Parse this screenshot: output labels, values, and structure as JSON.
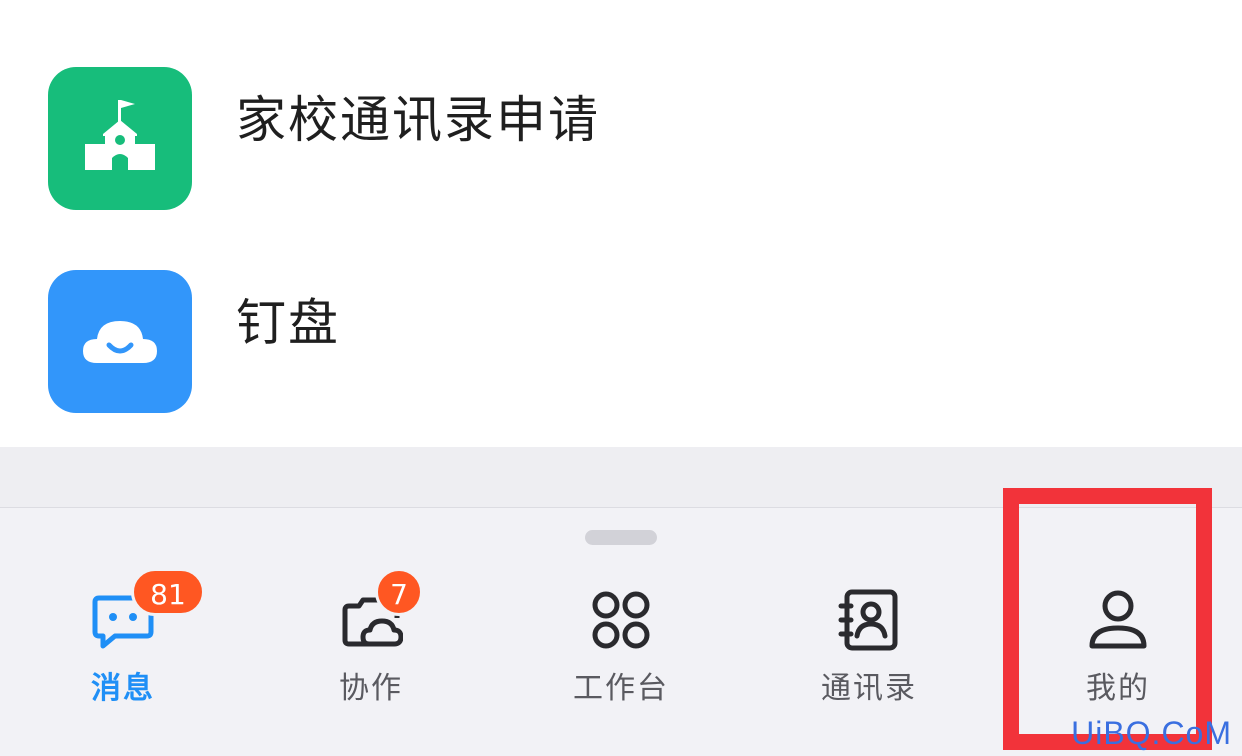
{
  "apps": [
    {
      "label": "家校通讯录申请",
      "icon": "school-icon",
      "color": "#17bd7b"
    },
    {
      "label": "钉盘",
      "icon": "cloud-smile-icon",
      "color": "#3296fa"
    }
  ],
  "tabbar": {
    "tabs": [
      {
        "label": "消息",
        "icon": "message-icon",
        "badge": "81",
        "active": true
      },
      {
        "label": "协作",
        "icon": "collab-icon",
        "badge": "7",
        "active": false
      },
      {
        "label": "工作台",
        "icon": "workbench-icon",
        "badge": "",
        "active": false
      },
      {
        "label": "通讯录",
        "icon": "contacts-icon",
        "badge": "",
        "active": false
      },
      {
        "label": "我的",
        "icon": "profile-icon",
        "badge": "",
        "active": false
      }
    ]
  },
  "colors": {
    "accent": "#1f8ff6",
    "badge": "#ff5722",
    "highlight": "#f2333a"
  },
  "watermark": "UiBQ.CoM"
}
